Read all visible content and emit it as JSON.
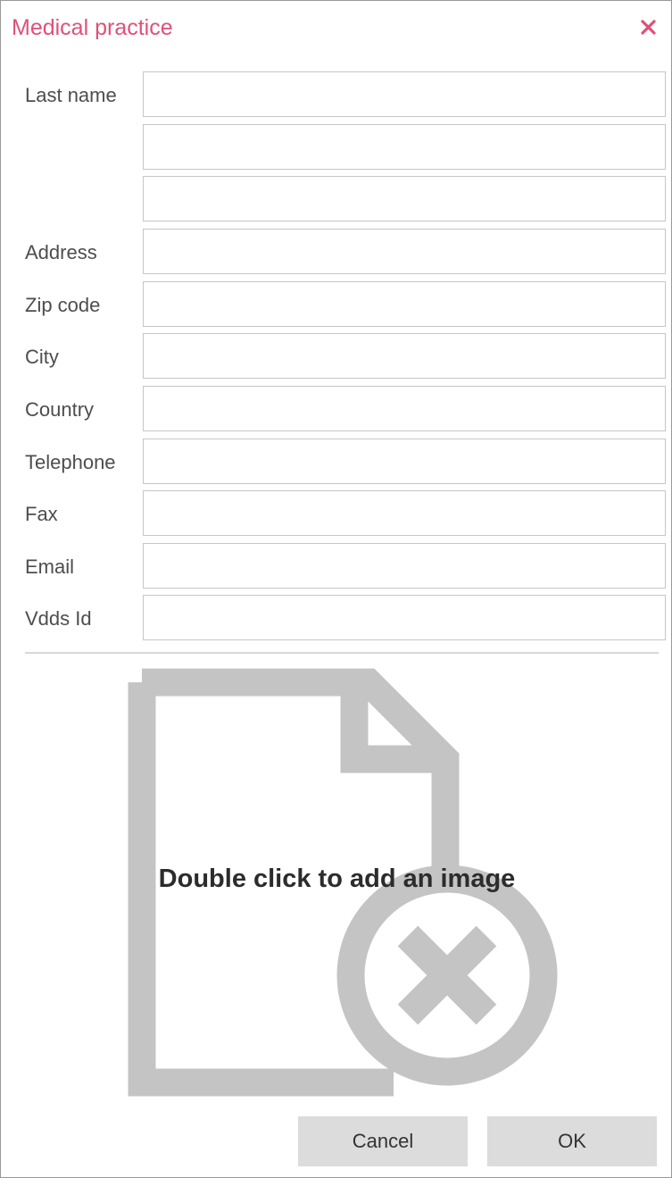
{
  "dialog": {
    "title": "Medical practice",
    "close_icon": "close-icon",
    "accent_color": "#e0507a"
  },
  "form": {
    "labels": {
      "last_name": "Last name",
      "address": "Address",
      "zip_code": "Zip code",
      "city": "City",
      "country": "Country",
      "telephone": "Telephone",
      "fax": "Fax",
      "email": "Email",
      "vdds_id": "Vdds Id"
    },
    "values": {
      "last_name_1": "",
      "last_name_2": "",
      "last_name_3": "",
      "address": "",
      "zip_code": "",
      "city": "",
      "country": "",
      "telephone": "",
      "fax": "",
      "email": "",
      "vdds_id": ""
    }
  },
  "image": {
    "hint": "Double click to add an image",
    "placeholder_icon": "missing-image-icon"
  },
  "buttons": {
    "cancel": "Cancel",
    "ok": "OK"
  }
}
